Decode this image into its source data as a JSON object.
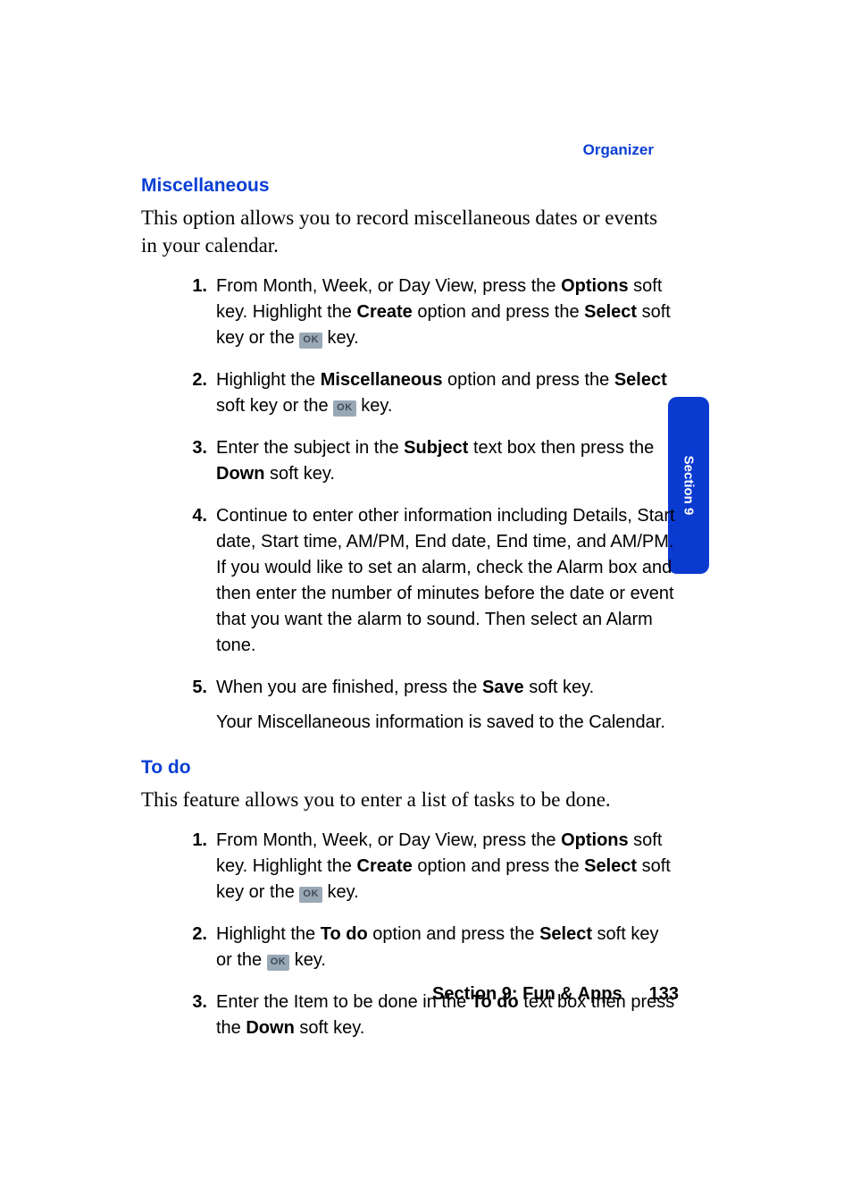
{
  "header": {
    "category": "Organizer"
  },
  "sideTab": {
    "label": "Section 9"
  },
  "footer": {
    "section": "Section 9: Fun & Apps",
    "page": "133"
  },
  "okKey": "OK",
  "sections": [
    {
      "title": "Miscellaneous",
      "intro": "This option allows you to record miscellaneous dates or events in your calendar.",
      "steps": [
        {
          "n": "1.",
          "parts": [
            "From Month, Week, or Day View, press the ",
            "Options",
            " soft key. Highlight the ",
            "Create",
            " option and press the ",
            "Select",
            " soft key or the "
          ],
          "tailAfterKey": " key."
        },
        {
          "n": "2.",
          "parts": [
            "Highlight the ",
            "Miscellaneous",
            " option and press the ",
            "Select",
            " soft key or the "
          ],
          "tailAfterKey": " key."
        },
        {
          "n": "3.",
          "parts": [
            "Enter the subject in the ",
            "Subject",
            " text box then press the ",
            "Down",
            " soft key."
          ]
        },
        {
          "n": "4.",
          "parts": [
            "Continue to enter other information including Details, Start date, Start time, AM/PM, End date, End time, and AM/PM. If you would like to set an alarm, check the Alarm box and then enter the number of minutes before the date or event that you want the alarm to sound. Then select an Alarm tone."
          ]
        },
        {
          "n": "5.",
          "parts": [
            "When you are finished, press the ",
            "Save",
            " soft key."
          ],
          "followup": "Your Miscellaneous information is saved to the Calendar."
        }
      ]
    },
    {
      "title": "To do",
      "intro": "This feature allows you to enter a list of tasks to be done.",
      "steps": [
        {
          "n": "1.",
          "parts": [
            "From Month, Week, or Day View, press the ",
            "Options",
            " soft key. Highlight the ",
            "Create",
            " option and press the ",
            "Select",
            " soft key or the "
          ],
          "tailAfterKey": " key."
        },
        {
          "n": "2.",
          "parts": [
            "Highlight the ",
            "To do",
            " option and press the ",
            "Select",
            " soft key or the "
          ],
          "tailAfterKey": " key."
        },
        {
          "n": "3.",
          "parts": [
            "Enter the Item to be done in the ",
            "To do",
            " text box then press the ",
            "Down",
            " soft key."
          ]
        }
      ]
    }
  ]
}
